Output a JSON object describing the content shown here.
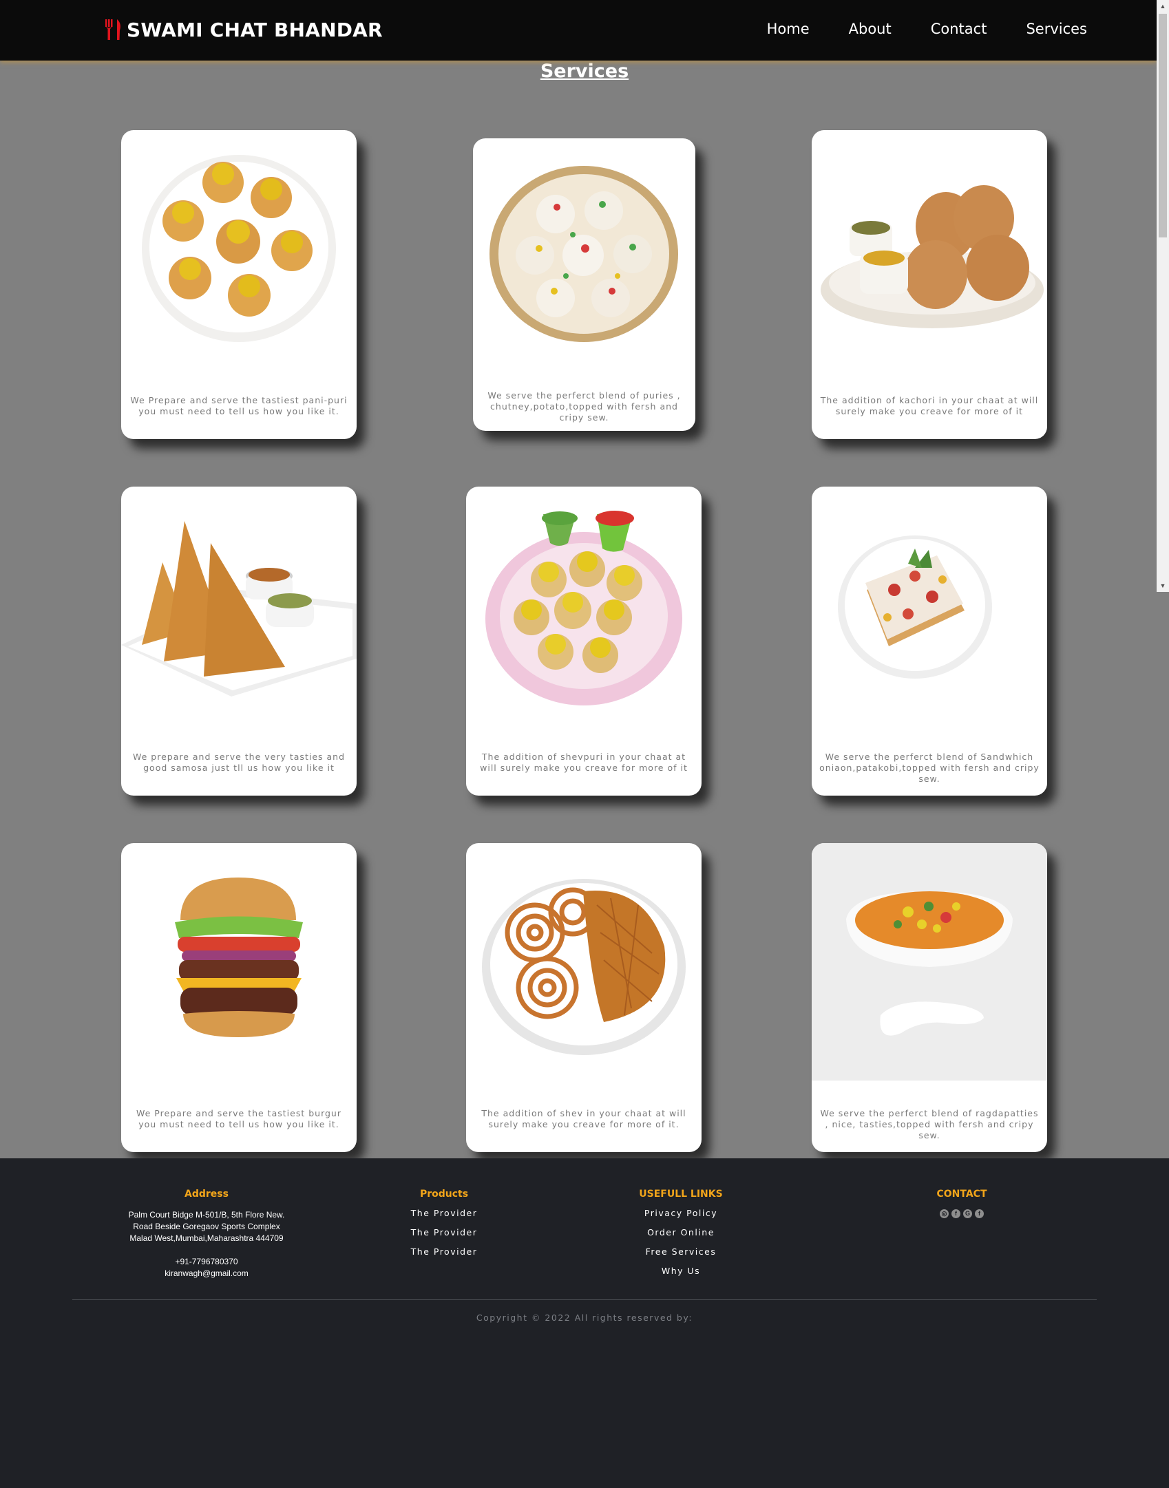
{
  "header": {
    "brand": "SWAMI CHAT BHANDAR",
    "nav": [
      "Home",
      "About",
      "Contact",
      "Services"
    ]
  },
  "main": {
    "title": "Services",
    "cards": [
      {
        "image": "pani-puri-plate",
        "text": "We Prepare and serve the tastiest pani-puri you must need to tell us how you like it."
      },
      {
        "image": "dahi-puri-platter",
        "text": "We serve the perferct blend of puries , chutney,potato,topped with fersh and cripy sew."
      },
      {
        "image": "kachori-bowl",
        "text": "The addition of kachori in your chaat at will surely make you creave for more of it"
      },
      {
        "image": "samosa-plate",
        "text": "We prepare and serve the very tasties and good samosa just tll us how you like it"
      },
      {
        "image": "shevpuri-plate",
        "text": "The addition of shevpuri in your chaat at will surely make you creave for more of it"
      },
      {
        "image": "sandwich-plate",
        "text": "We serve the perferct blend of Sandwhich oniaon,patakobi,topped with fersh and cripy sew."
      },
      {
        "image": "burger",
        "text": "We Prepare and serve the tastiest burgur you must need to tell us how you like it."
      },
      {
        "image": "chakli-shev-plate",
        "text": "The addition of shev in your chaat at will surely make you creave for more of it."
      },
      {
        "image": "ragda-bowl",
        "text": "We serve the perferct blend of ragdapatties , nice, tasties,topped with fersh and cripy sew."
      }
    ]
  },
  "footer": {
    "address": {
      "heading": "Address",
      "line1": "Palm Court Bidge M-501/B, 5th Flore New.",
      "line2": "Road Beside Goregaov Sports Complex",
      "line3": "Malad West,Mumbai,Maharashtra 444709",
      "phone": "+91-7796780370",
      "email": "kiranwagh@gmail.com"
    },
    "products": {
      "heading": "Products",
      "items": [
        "The Provider",
        "The Provider",
        "The Provider"
      ]
    },
    "links": {
      "heading": "USEFULL LINKS",
      "items": [
        "Privacy Policy",
        "Order Online",
        "Free Services",
        "Why Us"
      ]
    },
    "contact": {
      "heading": "CONTACT",
      "icons": [
        "instagram-icon",
        "facebook-icon",
        "google-icon",
        "facebook-icon"
      ]
    },
    "copyright": "Copyright © 2022 All rights reserved by:"
  },
  "colors": {
    "nav_bg": "#0b0b0b",
    "page_bg": "#808080",
    "footer_bg": "#1f2126",
    "footer_heading": "#f2a51a",
    "logo_red": "#e0141e"
  }
}
